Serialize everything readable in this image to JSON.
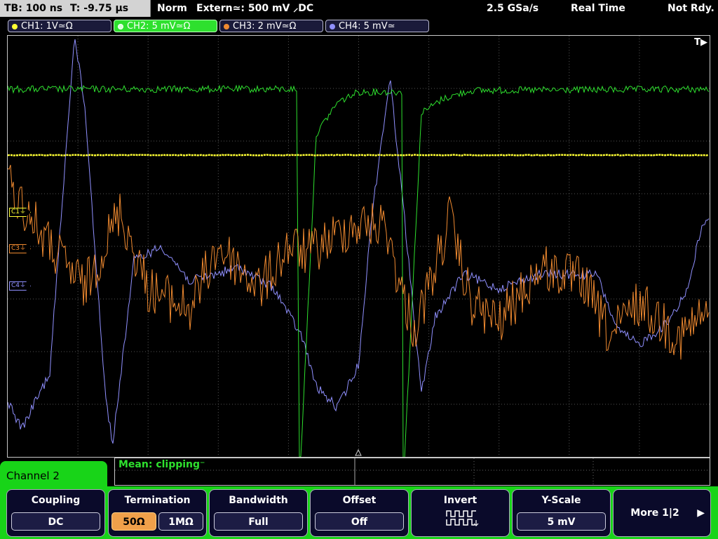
{
  "status_bar": {
    "timebase": "TB: 100 ns",
    "trigger_time": "T: -9.75 µs",
    "trigger_mode": "Norm",
    "trigger_source": "Extern≃: 500 mV ⸝DC",
    "sample_rate": "2.5 GSa/s",
    "acq_mode": "Real Time",
    "acq_status": "Not Rdy."
  },
  "channel_tabs": [
    {
      "label": "CH1: 1V≃Ω",
      "color": "#ffff33"
    },
    {
      "label": "CH2: 5 mV≃Ω",
      "color": "#2ee02e"
    },
    {
      "label": "CH3: 2 mV≃Ω",
      "color": "#f08a30"
    },
    {
      "label": "CH4: 5 mV≃",
      "color": "#9090ff"
    }
  ],
  "trigger_marker": "T▶",
  "channel_markers": {
    "c1": "C1⏚",
    "c3": "C3⏚",
    "c4": "C4⏚"
  },
  "measurement": "Mean: clipping⁻",
  "menu": {
    "title": "Channel 2",
    "coupling": {
      "label": "Coupling",
      "value": "DC"
    },
    "termination": {
      "label": "Termination",
      "options": [
        "50Ω",
        "1MΩ"
      ],
      "selected": "50Ω"
    },
    "bandwidth": {
      "label": "Bandwidth",
      "value": "Full"
    },
    "offset": {
      "label": "Offset",
      "value": "Off"
    },
    "invert": {
      "label": "Invert"
    },
    "yscale": {
      "label": "Y-Scale",
      "value": "5 mV"
    },
    "more": {
      "label": "More 1|2"
    }
  },
  "colors": {
    "ch1": "#ffff33",
    "ch2": "#2ee02e",
    "ch3": "#f08a30",
    "ch4": "#9090ff",
    "grid": "#555555"
  }
}
